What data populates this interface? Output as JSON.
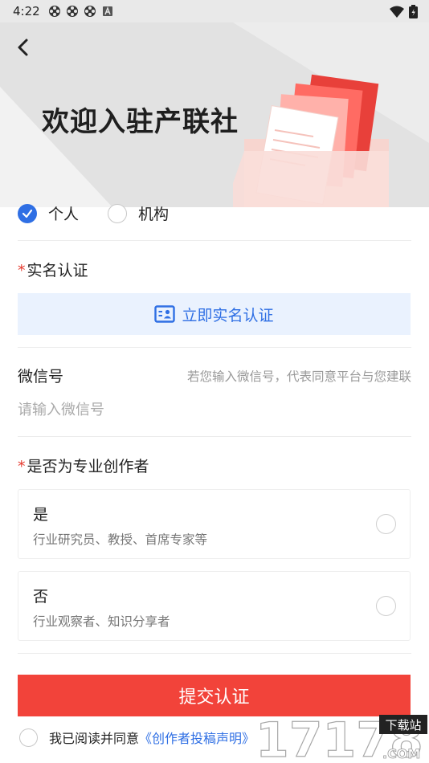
{
  "status_bar": {
    "time": "4:22",
    "notification_icons": [
      "spinner-icon",
      "spinner-icon",
      "spinner-icon",
      "app-a-icon"
    ],
    "right_icons": [
      "wifi-icon",
      "battery-icon"
    ]
  },
  "header": {
    "back_icon": "back-arrow-icon",
    "title": "欢迎入驻产联社",
    "illustration": "folder-documents-illustration"
  },
  "account_type": {
    "options": [
      {
        "label": "个人",
        "selected": true
      },
      {
        "label": "机构",
        "selected": false
      }
    ]
  },
  "real_name": {
    "required_mark": "*",
    "label": "实名认证",
    "button_label": "立即实名认证",
    "button_icon": "id-card-icon"
  },
  "wechat": {
    "label": "微信号",
    "hint": "若您输入微信号，代表同意平台与您建联",
    "placeholder": "请输入微信号",
    "value": ""
  },
  "creator": {
    "required_mark": "*",
    "label": "是否为专业创作者",
    "options": [
      {
        "title": "是",
        "desc": "行业研究员、教授、首席专家等",
        "selected": false
      },
      {
        "title": "否",
        "desc": "行业观察者、知识分享者",
        "selected": false
      }
    ]
  },
  "submit": {
    "label": "提交认证"
  },
  "agreement": {
    "text": "我已阅读并同意",
    "link": "《创作者投稿声明》",
    "checked": false
  },
  "watermark": {
    "main": "17178",
    "badge": "下载站",
    "suffix": ".COM"
  },
  "colors": {
    "accent_blue": "#2f6fe4",
    "required_red": "#e63a2e",
    "submit_red": "#f2433a",
    "verify_bg": "#eaf2fe",
    "header_bg": "#ececec"
  }
}
